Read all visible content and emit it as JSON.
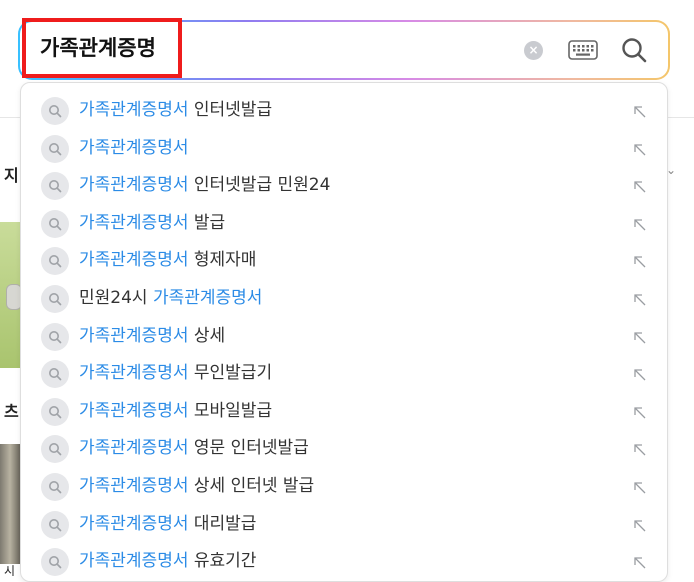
{
  "search": {
    "query": "가족관계증명",
    "clear_icon": "×"
  },
  "background": {
    "text_1": "지",
    "text_2": "츠",
    "text_3": "시"
  },
  "suggestions": [
    {
      "highlight": "가족관계증명서",
      "rest": " 인터넷발급"
    },
    {
      "highlight": "가족관계증명서",
      "rest": ""
    },
    {
      "highlight": "가족관계증명서",
      "rest": " 인터넷발급 민원24"
    },
    {
      "highlight": "가족관계증명서",
      "rest": " 발급"
    },
    {
      "highlight": "가족관계증명서",
      "rest": " 형제자매"
    },
    {
      "prefix": "민원24시 ",
      "highlight": "가족관계증명서",
      "rest": ""
    },
    {
      "highlight": "가족관계증명서",
      "rest": " 상세"
    },
    {
      "highlight": "가족관계증명서",
      "rest": " 무인발급기"
    },
    {
      "highlight": "가족관계증명서",
      "rest": " 모바일발급"
    },
    {
      "highlight": "가족관계증명서",
      "rest": " 영문 인터넷발급"
    },
    {
      "highlight": "가족관계증명서",
      "rest": " 상세 인터넷 발급"
    },
    {
      "highlight": "가족관계증명서",
      "rest": " 대리발급"
    },
    {
      "highlight": "가족관계증명서",
      "rest": " 유효기간"
    }
  ],
  "colors": {
    "highlight": "#2b8be6",
    "query_box_outline": "#ef1c1c"
  }
}
